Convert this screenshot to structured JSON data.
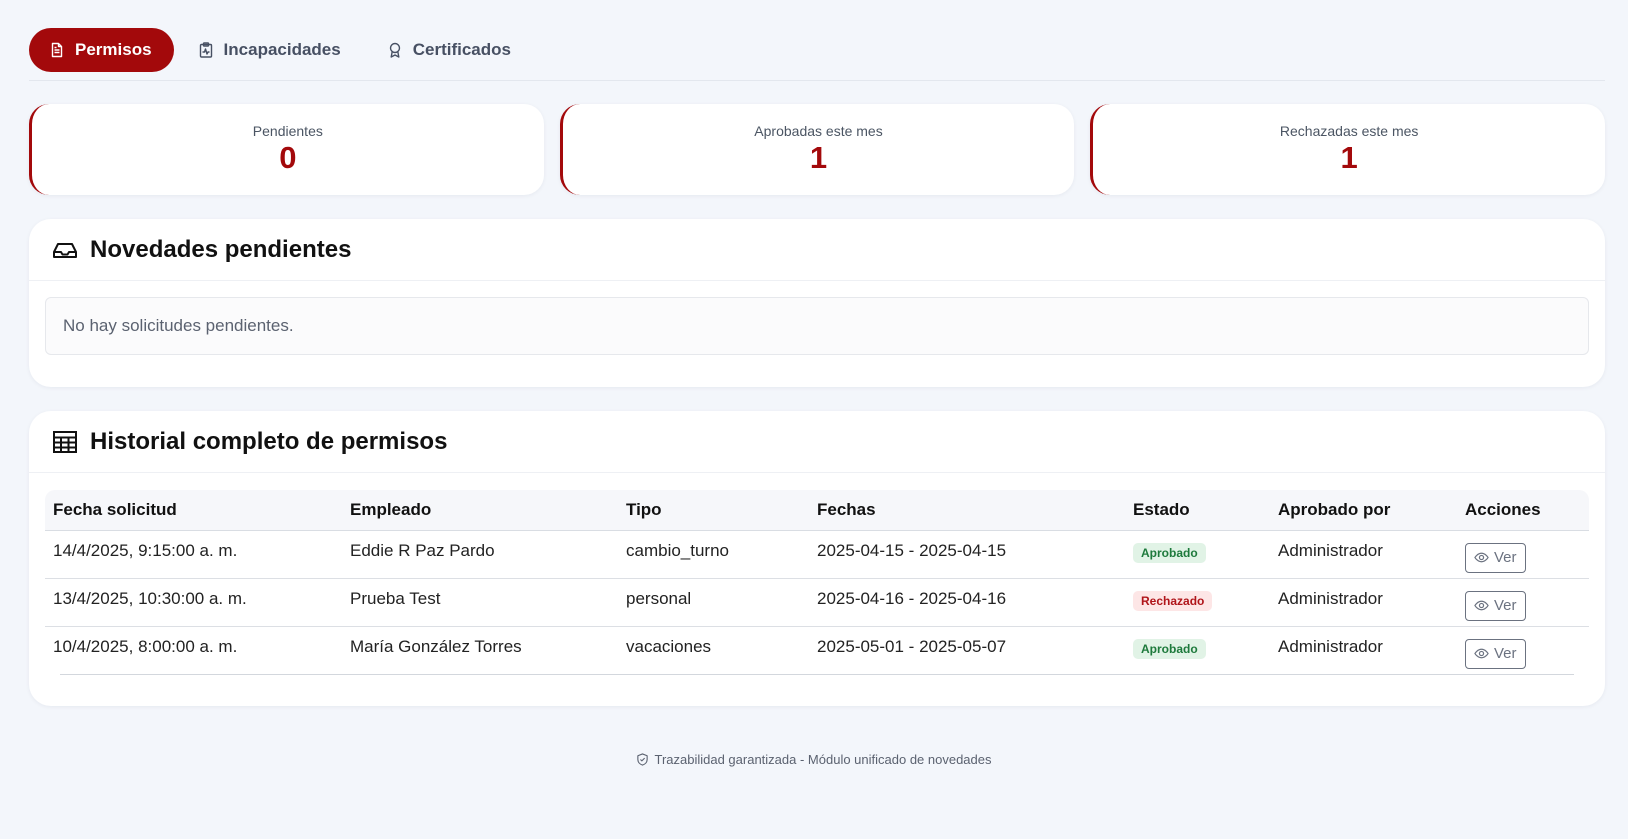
{
  "tabs": [
    {
      "label": "Permisos",
      "icon": "document-icon",
      "active": true
    },
    {
      "label": "Incapacidades",
      "icon": "clipboard-pulse-icon",
      "active": false
    },
    {
      "label": "Certificados",
      "icon": "award-icon",
      "active": false
    }
  ],
  "stats": [
    {
      "label": "Pendientes",
      "value": "0"
    },
    {
      "label": "Aprobadas este mes",
      "value": "1"
    },
    {
      "label": "Rechazadas este mes",
      "value": "1"
    }
  ],
  "pending": {
    "title": "Novedades pendientes",
    "icon": "inbox-icon",
    "empty_message": "No hay solicitudes pendientes."
  },
  "history": {
    "title": "Historial completo de permisos",
    "icon": "table-icon",
    "columns": [
      "Fecha solicitud",
      "Empleado",
      "Tipo",
      "Fechas",
      "Estado",
      "Aprobado por",
      "Acciones"
    ],
    "rows": [
      {
        "fecha": "14/4/2025, 9:15:00 a. m.",
        "empleado": "Eddie R Paz Pardo",
        "tipo": "cambio_turno",
        "fechas": "2025-04-15 - 2025-04-15",
        "estado": "Aprobado",
        "aprobado_por": "Administrador",
        "accion": "Ver"
      },
      {
        "fecha": "13/4/2025, 10:30:00 a. m.",
        "empleado": "Prueba Test",
        "tipo": "personal",
        "fechas": "2025-04-16 - 2025-04-16",
        "estado": "Rechazado",
        "aprobado_por": "Administrador",
        "accion": "Ver"
      },
      {
        "fecha": "10/4/2025, 8:00:00 a. m.",
        "empleado": "María González Torres",
        "tipo": "vacaciones",
        "fechas": "2025-05-01 - 2025-05-07",
        "estado": "Aprobado",
        "aprobado_por": "Administrador",
        "accion": "Ver"
      }
    ]
  },
  "footer": {
    "text": "Trazabilidad garantizada - Módulo unificado de novedades",
    "icon": "shield-check-icon"
  },
  "colors": {
    "brand": "#a3090b",
    "approved_bg": "#e1f3e6",
    "approved_text": "#1e7a3c",
    "rejected_bg": "#fde6e6",
    "rejected_text": "#b0151a"
  }
}
